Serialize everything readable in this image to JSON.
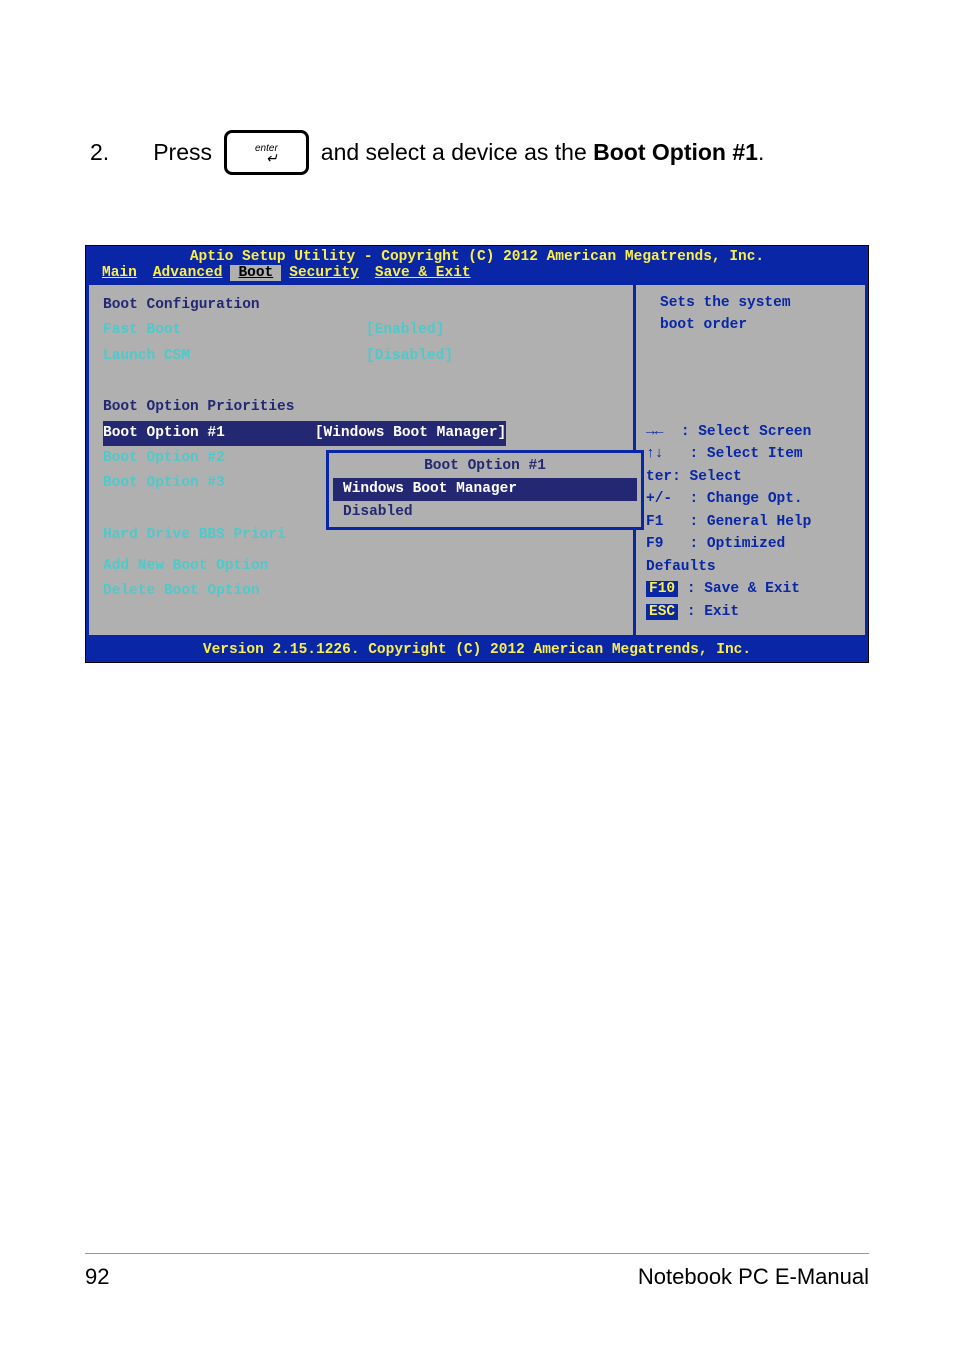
{
  "doc": {
    "step": "2.",
    "press_text": "Press",
    "enter_label": "enter",
    "instruction_after": " and select a device as the ",
    "boot_option_bold": "Boot Option #1",
    "instruction_end": "."
  },
  "bios": {
    "header": "Aptio Setup Utility - Copyright (C) 2012 American Megatrends, Inc.",
    "tabs": {
      "main": "Main",
      "advanced": "Advanced",
      "boot": "Boot",
      "security": "Security",
      "save_exit": "Save & Exit"
    },
    "left": {
      "boot_config": "Boot Configuration",
      "fast_boot_label": "Fast Boot",
      "fast_boot_value": "[Enabled]",
      "launch_csm_label": "Launch CSM",
      "launch_csm_value": "[Disabled]",
      "boot_priorities": "Boot Option Priorities",
      "boot1_label": "Boot Option #1",
      "boot1_value": "[Windows Boot Manager]",
      "boot2_label": "Boot Option #2",
      "boot3_label": "Boot Option #3",
      "hdd_bbs": "Hard Drive BBS Priori",
      "add_boot": "Add New Boot Option",
      "delete_boot": "Delete Boot Option"
    },
    "popup": {
      "title": "Boot Option #1",
      "opt1": "Windows Boot Manager",
      "opt2": "Disabled"
    },
    "right": {
      "desc1": "Sets the system",
      "desc2": "boot order",
      "help_arrows": "→←",
      "help_select_screen": ": Select Screen",
      "help_select_item": ": Select Item",
      "help_select": "ter: Select",
      "help_change": ": Change Opt.",
      "help_general": ": General Help",
      "help_optimized": ": Optimized Defaults",
      "help_f10_key": "F10",
      "help_save": ": Save & Exit",
      "help_esc_key": "ESC",
      "help_exit": ": Exit"
    },
    "footer": "Version 2.15.1226. Copyright (C) 2012 American Megatrends, Inc."
  },
  "page_footer": {
    "left": "92",
    "right": "Notebook PC E-Manual"
  }
}
